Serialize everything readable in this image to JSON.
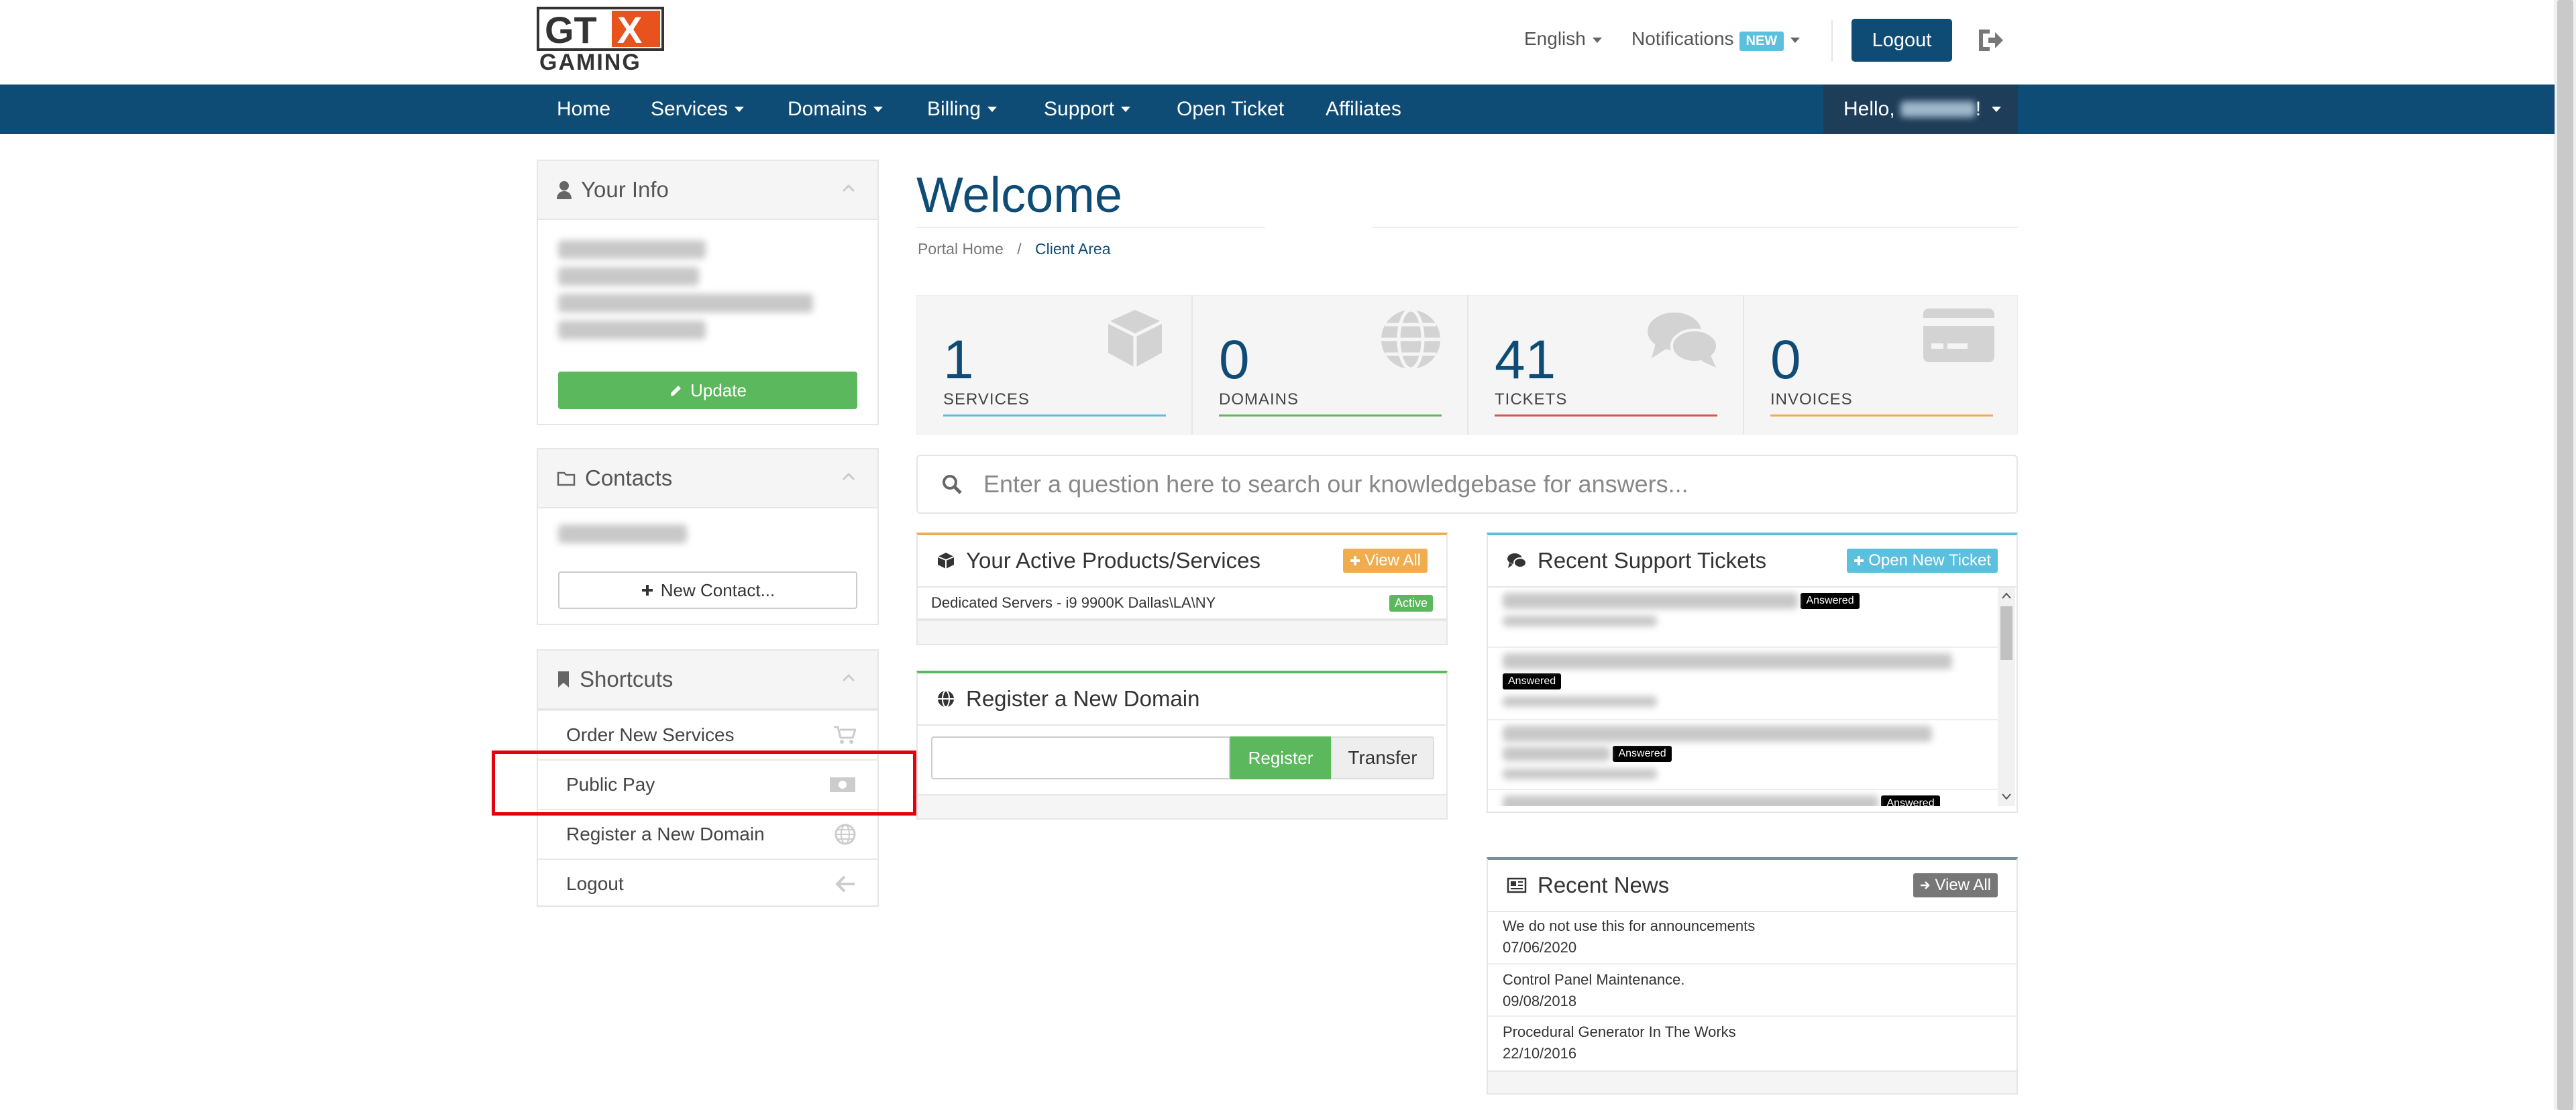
{
  "header": {
    "logo_text": "GTX GAMING",
    "language_label": "English",
    "notifications_label": "Notifications",
    "notifications_badge": "NEW",
    "logout_label": "Logout"
  },
  "nav": {
    "items": [
      {
        "label": "Home"
      },
      {
        "label": "Services"
      },
      {
        "label": "Domains"
      },
      {
        "label": "Billing"
      },
      {
        "label": "Support"
      },
      {
        "label": "Open Ticket"
      },
      {
        "label": "Affiliates"
      }
    ],
    "hello_label": "Hello,",
    "hello_suffix": "!"
  },
  "sidebar": {
    "your_info": {
      "title": "Your Info",
      "update_label": "Update"
    },
    "contacts": {
      "title": "Contacts",
      "new_contact_label": "New Contact..."
    },
    "shortcuts": {
      "title": "Shortcuts",
      "items": [
        {
          "label": "Order New Services",
          "icon": "shopping-cart-icon"
        },
        {
          "label": "Public Pay",
          "icon": "money-icon"
        },
        {
          "label": "Register a New Domain",
          "icon": "globe-icon"
        },
        {
          "label": "Logout",
          "icon": "arrow-left-icon"
        }
      ]
    }
  },
  "main": {
    "title": "Welcome",
    "breadcrumb": {
      "home": "Portal Home",
      "separator": "/",
      "current": "Client Area"
    },
    "tiles": [
      {
        "value": "1",
        "label": "SERVICES",
        "color": "#5bc0de",
        "icon": "cube-icon"
      },
      {
        "value": "0",
        "label": "DOMAINS",
        "color": "#5cb85c",
        "icon": "globe-icon"
      },
      {
        "value": "41",
        "label": "TICKETS",
        "color": "#d9534f",
        "icon": "comments-icon"
      },
      {
        "value": "0",
        "label": "INVOICES",
        "color": "#f0ad4e",
        "icon": "credit-card-icon"
      }
    ],
    "kb_search_placeholder": "Enter a question here to search our knowledgebase for answers...",
    "products": {
      "title": "Your Active Products/Services",
      "view_all_label": "View All",
      "accent": "#f0ad4e",
      "items": [
        {
          "name": "Dedicated Servers - i9 9900K Dallas\\LA\\NY",
          "status": "Active"
        }
      ]
    },
    "register_domain": {
      "title": "Register a New Domain",
      "register_label": "Register",
      "transfer_label": "Transfer",
      "accent": "#5cb85c"
    },
    "tickets": {
      "title": "Recent Support Tickets",
      "open_new_label": "Open New Ticket",
      "accent": "#5bc0de",
      "status_label": "Answered"
    },
    "news": {
      "title": "Recent News",
      "view_all_label": "View All",
      "items": [
        {
          "title": "We do not use this for announcements",
          "date": "07/06/2020"
        },
        {
          "title": "Control Panel Maintenance.",
          "date": "09/08/2018"
        },
        {
          "title": "Procedural Generator In The Works",
          "date": "22/10/2016"
        }
      ]
    }
  }
}
